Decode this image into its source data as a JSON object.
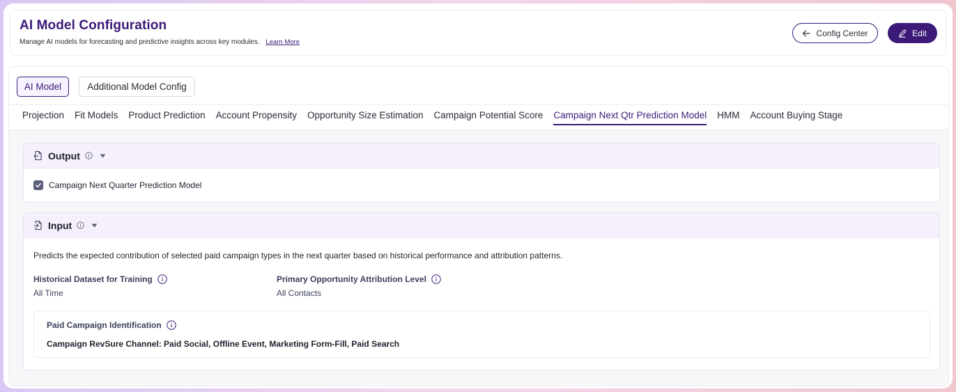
{
  "header": {
    "title": "AI Model Configuration",
    "subtitle": "Manage AI models for forecasting and predictive insights across key modules.",
    "learn_more": "Learn More",
    "config_center_label": "Config Center",
    "edit_label": "Edit",
    "accent_color": "#3b1a78"
  },
  "model_pills": [
    {
      "label": "AI Model",
      "active": true
    },
    {
      "label": "Additional Model Config",
      "active": false
    }
  ],
  "tabs": [
    {
      "label": "Projection"
    },
    {
      "label": "Fit Models"
    },
    {
      "label": "Product Prediction"
    },
    {
      "label": "Account Propensity"
    },
    {
      "label": "Opportunity Size Estimation"
    },
    {
      "label": "Campaign Potential Score"
    },
    {
      "label": "Campaign Next Qtr Prediction Model",
      "active": true
    },
    {
      "label": "HMM"
    },
    {
      "label": "Account Buying Stage"
    }
  ],
  "output": {
    "title": "Output",
    "checkbox_label": "Campaign Next Quarter Prediction Model",
    "checked": true
  },
  "input": {
    "title": "Input",
    "description": "Predicts the expected contribution of selected paid campaign types in the next quarter based on historical performance and attribution patterns.",
    "historical_label": "Historical Dataset for Training",
    "historical_value": "All Time",
    "attribution_label": "Primary Opportunity Attribution Level",
    "attribution_value": "All Contacts",
    "paid_label": "Paid Campaign Identification",
    "paid_value": "Campaign RevSure Channel: Paid Social, Offline Event, Marketing Form-Fill, Paid Search"
  }
}
